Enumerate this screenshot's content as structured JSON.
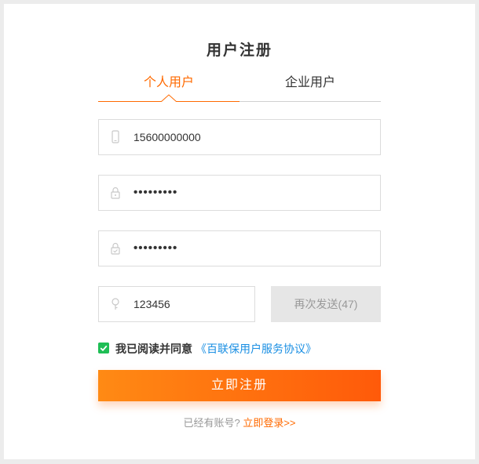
{
  "page": {
    "title": "用户注册"
  },
  "tabs": [
    {
      "label": "个人用户",
      "active": true
    },
    {
      "label": "企业用户",
      "active": false
    }
  ],
  "form": {
    "phone": {
      "icon": "mobile-phone-icon",
      "value": "15600000000"
    },
    "password": {
      "icon": "lock-icon",
      "value": "•••••••••"
    },
    "confirm_password": {
      "icon": "lock-check-icon",
      "value": "•••••••••"
    },
    "sms_code": {
      "icon": "bulb-key-icon",
      "value": "123456"
    },
    "resend_label": "再次发送(47)"
  },
  "agreement": {
    "checked": true,
    "text": "我已阅读并同意",
    "link": "《百联保用户服务协议》"
  },
  "submit_label": "立即注册",
  "footer": {
    "prompt": "已经有账号?",
    "login_link": "立即登录>>"
  },
  "colors": {
    "accent": "#ff6a00",
    "link_blue": "#1a8fe3",
    "check_green": "#1fbe55",
    "button_gradient_start": "#ff8a14",
    "button_gradient_end": "#ff5a0a",
    "disabled_bg": "#e6e6e6"
  }
}
